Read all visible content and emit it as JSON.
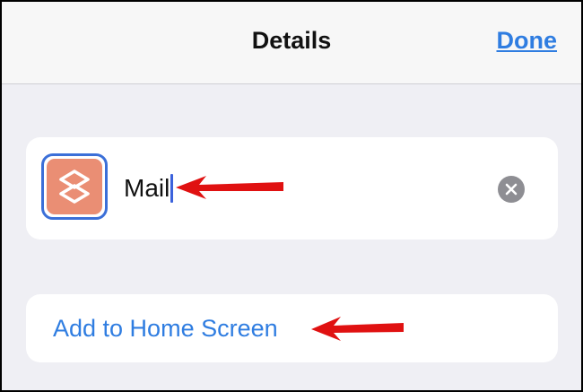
{
  "nav": {
    "title": "Details",
    "done_label": "Done"
  },
  "shortcut": {
    "icon": "shortcuts-icon",
    "name_value": "Mail",
    "clear_icon": "clear-x-icon"
  },
  "actions": {
    "add_to_home_label": "Add to Home Screen"
  },
  "annotations": {
    "arrow_icon": "red-arrow-icon",
    "arrow_color": "#e01111"
  },
  "colors": {
    "accent": "#2f7de1",
    "icon_bg": "#ea8e74",
    "selection_border": "#3b6fd8",
    "background": "#efeff4"
  }
}
